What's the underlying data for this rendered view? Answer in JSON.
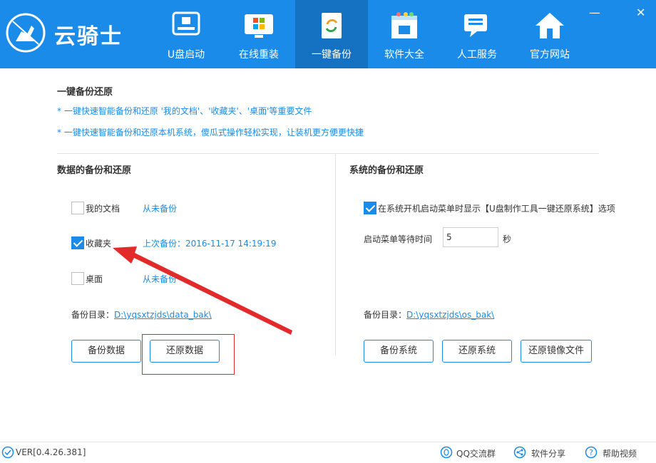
{
  "app": {
    "brand_name": "云骑士",
    "window_controls": {
      "minimize": "—",
      "close": "✕"
    }
  },
  "nav": {
    "items": [
      {
        "label": "U盘启动",
        "icon": "usb-drive-icon"
      },
      {
        "label": "在线重装",
        "icon": "windows-install-icon"
      },
      {
        "label": "一键备份",
        "icon": "backup-sync-icon",
        "active": true
      },
      {
        "label": "软件大全",
        "icon": "software-box-icon"
      },
      {
        "label": "人工服务",
        "icon": "chat-service-icon"
      },
      {
        "label": "官方网站",
        "icon": "home-icon"
      }
    ]
  },
  "content": {
    "title": "一键备份还原",
    "tip1": "* 一键快速智能备份和还原 '我的文档'、'收藏夹'、'桌面'等重要文件",
    "tip2": "* 一键快速智能备份和还原本机系统，傻瓜式操作轻松实现，让装机更方便更快捷"
  },
  "data_backup": {
    "heading": "数据的备份和还原",
    "items": [
      {
        "label": "我的文档",
        "checked": false,
        "status": "从未备份"
      },
      {
        "label": "收藏夹",
        "checked": true,
        "status": "上次备份：2016-11-17 14:19:19"
      },
      {
        "label": "桌面",
        "checked": false,
        "status": "从未备份"
      }
    ],
    "dir_label": "备份目录：",
    "dir_path": "D:\\yqsxtzjds\\data_bak\\",
    "backup_button": "备份数据",
    "restore_button": "还原数据"
  },
  "system_backup": {
    "heading": "系统的备份和还原",
    "boot_menu_option": "在系统开机启动菜单时显示【U盘制作工具一键还原系统】选项",
    "boot_menu_checked": true,
    "wait_label": "启动菜单等待时间",
    "wait_value": "5",
    "wait_unit": "秒",
    "dir_label": "备份目录：",
    "dir_path": "D:\\yqsxtzjds\\os_bak\\",
    "backup_button": "备份系统",
    "restore_button": "还原系统",
    "restore_image_button": "还原镜像文件"
  },
  "footer": {
    "version": "VER[0.4.26.381]",
    "qq_group": "QQ交流群",
    "share": "软件分享",
    "help_video": "帮助视频"
  },
  "colors": {
    "header_bg": "#1a8be8",
    "active_tab_bg": "#1572c2",
    "accent": "#1a8be8",
    "annotation_red": "#e22a2a"
  }
}
